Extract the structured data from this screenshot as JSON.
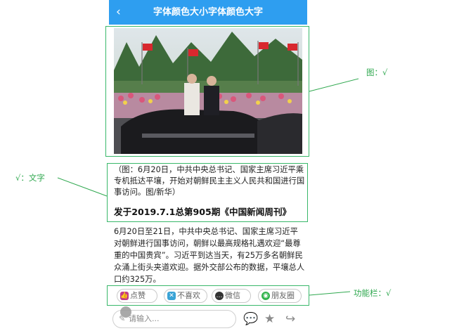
{
  "header": {
    "back_icon": "chevron-left-icon",
    "back_glyph": "‹",
    "title": "字体颜色大小字体颜色大字"
  },
  "article": {
    "caption": "（图：6月20日，中共中央总书记、国家主席习近平乘专机抵达平壤，开始对朝鲜民主主义人民共和国进行国事访问。图/新华）",
    "headline": "发于2019.7.1总第905期《中国新闻周刊》",
    "body": "6月20日至21日，中共中央总书记、国家主席习近平对朝鲜进行国事访问，朝鲜以最高规格礼遇欢迎“最尊重的中国贵宾”。习近平到达当天，有25万多名朝鲜民众涌上街头夹道欢迎。据外交部公布的数据，平壤总人口约325万。"
  },
  "actions": [
    {
      "label": "点赞",
      "icon": "thumbs-up-icon",
      "color": "#c23b8a"
    },
    {
      "label": "不喜欢",
      "icon": "thumbs-down-icon",
      "color": "#3aa3d6"
    },
    {
      "label": "微信",
      "icon": "wechat-icon",
      "color": "#333333"
    },
    {
      "label": "朋友圈",
      "icon": "moments-icon",
      "color": "#2fb24a"
    }
  ],
  "comment": {
    "placeholder": "请输入..."
  },
  "annotations": {
    "image": "图：√",
    "text": "√：文字",
    "function_bar": "功能栏：√"
  },
  "colors": {
    "header_bg": "#2e9ef0",
    "annotation": "#2fa84f"
  }
}
